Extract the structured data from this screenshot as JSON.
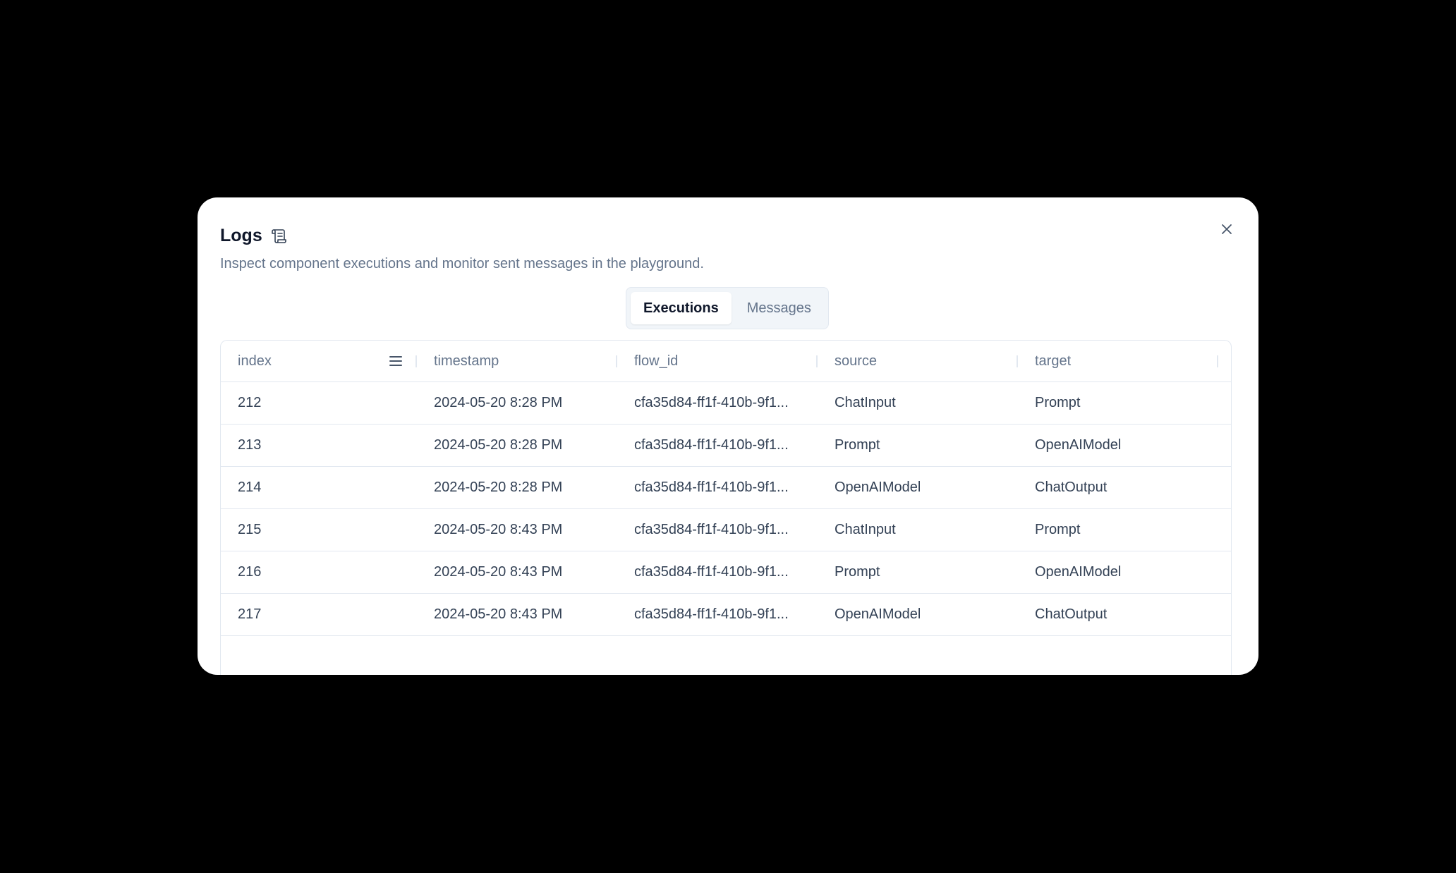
{
  "dialog": {
    "title": "Logs",
    "subtitle": "Inspect component executions and monitor sent messages in the playground.",
    "title_icon": "scroll-icon",
    "close_icon": "close-icon"
  },
  "tabs": [
    {
      "label": "Executions",
      "active": true
    },
    {
      "label": "Messages",
      "active": false
    }
  ],
  "table": {
    "columns": [
      "index",
      "timestamp",
      "flow_id",
      "source",
      "target"
    ],
    "rows": [
      {
        "index": "212",
        "timestamp": "2024-05-20 8:28 PM",
        "flow_id": "cfa35d84-ff1f-410b-9f1...",
        "source": "ChatInput",
        "target": "Prompt"
      },
      {
        "index": "213",
        "timestamp": "2024-05-20 8:28 PM",
        "flow_id": "cfa35d84-ff1f-410b-9f1...",
        "source": "Prompt",
        "target": "OpenAIModel"
      },
      {
        "index": "214",
        "timestamp": "2024-05-20 8:28 PM",
        "flow_id": "cfa35d84-ff1f-410b-9f1...",
        "source": "OpenAIModel",
        "target": "ChatOutput"
      },
      {
        "index": "215",
        "timestamp": "2024-05-20 8:43 PM",
        "flow_id": "cfa35d84-ff1f-410b-9f1...",
        "source": "ChatInput",
        "target": "Prompt"
      },
      {
        "index": "216",
        "timestamp": "2024-05-20 8:43 PM",
        "flow_id": "cfa35d84-ff1f-410b-9f1...",
        "source": "Prompt",
        "target": "OpenAIModel"
      },
      {
        "index": "217",
        "timestamp": "2024-05-20 8:43 PM",
        "flow_id": "cfa35d84-ff1f-410b-9f1...",
        "source": "OpenAIModel",
        "target": "ChatOutput"
      }
    ]
  },
  "colors": {
    "backdrop": "#000000",
    "surface": "#ffffff",
    "border": "#e2e8f0",
    "text_primary": "#0f172a",
    "text_muted": "#64748b"
  }
}
